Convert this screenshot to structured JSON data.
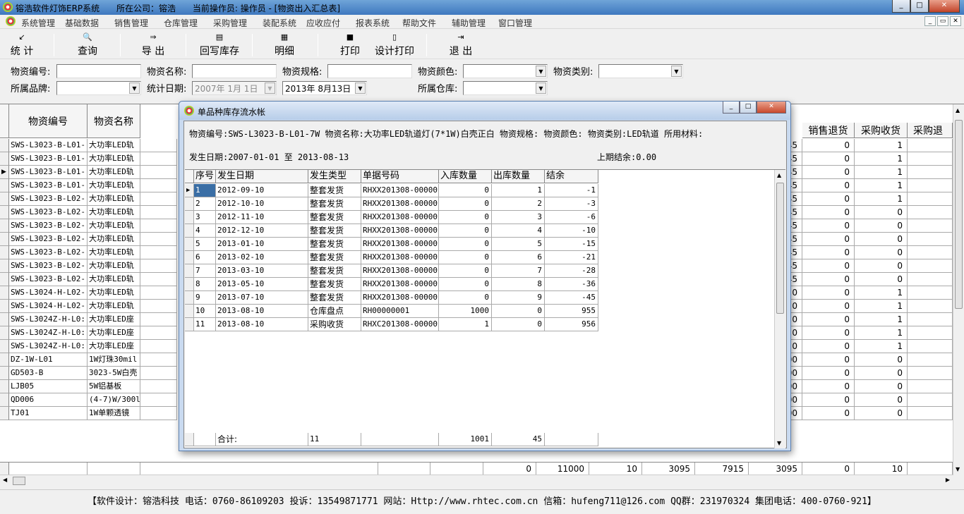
{
  "titlebar": {
    "app": "镕浩软件灯饰ERP系统",
    "company": "所在公司：镕浩",
    "operator": "当前操作员: 操作员 - [物资出入汇总表]",
    "min": "_",
    "max": "□",
    "close": "✕"
  },
  "menu": [
    "系统管理",
    "基础数据",
    "销售管理",
    "仓库管理",
    "采购管理",
    "装配系统",
    "应收应付",
    "报表系统",
    "帮助文件",
    "辅助管理",
    "窗口管理"
  ],
  "mdi_buttons": [
    "_",
    "▭",
    "✕"
  ],
  "toolbar": [
    {
      "label": "统 计",
      "icon": "tally-icon",
      "glyph": "↙"
    },
    {
      "label": "查询",
      "icon": "query-icon",
      "glyph": "🔍"
    },
    {
      "label": "导 出",
      "icon": "export-icon",
      "glyph": "⇒"
    },
    {
      "label": "回写库存",
      "icon": "writeback-icon",
      "glyph": "▤"
    },
    {
      "label": "明细",
      "icon": "detail-icon",
      "glyph": "▦"
    },
    {
      "label": "打印",
      "icon": "print-icon",
      "glyph": "■"
    },
    {
      "label": "设计打印",
      "icon": "design-print-icon",
      "glyph": "▯"
    },
    {
      "label": "退 出",
      "icon": "exit-icon",
      "glyph": "⇥"
    }
  ],
  "filters": {
    "code_label": "物资编号:",
    "name_label": "物资名称:",
    "spec_label": "物资规格:",
    "color_label": "物资颜色:",
    "category_label": "物资类别:",
    "brand_label": "所属品牌:",
    "date_label": "统计日期:",
    "date_from": "2007年 1月 1日",
    "date_to": "2013年 8月13日",
    "warehouse_label": "所属仓库:"
  },
  "main_grid": {
    "headers": [
      "物资编号",
      "物资名称",
      "销售退货",
      "采购收货",
      "采购退"
    ],
    "rows": [
      {
        "code": "SWS-L3023-B-L01-",
        "name": "大功率LED轨",
        "c1": "45",
        "ret": "0",
        "rec": "1"
      },
      {
        "code": "SWS-L3023-B-L01-",
        "name": "大功率LED轨",
        "c1": "45",
        "ret": "0",
        "rec": "1"
      },
      {
        "code": "SWS-L3023-B-L01-",
        "name": "大功率LED轨",
        "c1": "45",
        "ret": "0",
        "rec": "1"
      },
      {
        "code": "SWS-L3023-B-L01-",
        "name": "大功率LED轨",
        "c1": "45",
        "ret": "0",
        "rec": "1"
      },
      {
        "code": "SWS-L3023-B-L02-",
        "name": "大功率LED轨",
        "c1": "45",
        "ret": "0",
        "rec": "1"
      },
      {
        "code": "SWS-L3023-B-L02-",
        "name": "大功率LED轨",
        "c1": "45",
        "ret": "0",
        "rec": "0"
      },
      {
        "code": "SWS-L3023-B-L02-",
        "name": "大功率LED轨",
        "c1": "45",
        "ret": "0",
        "rec": "0"
      },
      {
        "code": "SWS-L3023-B-L02-",
        "name": "大功率LED轨",
        "c1": "45",
        "ret": "0",
        "rec": "0"
      },
      {
        "code": "SWS-L3023-B-L02-",
        "name": "大功率LED轨",
        "c1": "45",
        "ret": "0",
        "rec": "0"
      },
      {
        "code": "SWS-L3023-B-L02-",
        "name": "大功率LED轨",
        "c1": "45",
        "ret": "0",
        "rec": "0"
      },
      {
        "code": "SWS-L3023-B-L02-",
        "name": "大功率LED轨",
        "c1": "45",
        "ret": "0",
        "rec": "0"
      },
      {
        "code": "SWS-L3024-H-L02-",
        "name": "大功率LED轨",
        "c1": "0",
        "ret": "0",
        "rec": "1"
      },
      {
        "code": "SWS-L3024-H-L02-",
        "name": "大功率LED轨",
        "c1": "0",
        "ret": "0",
        "rec": "1"
      },
      {
        "code": "SWS-L3024Z-H-L0:",
        "name": "大功率LED座",
        "c1": "0",
        "ret": "0",
        "rec": "1"
      },
      {
        "code": "SWS-L3024Z-H-L0:",
        "name": "大功率LED座",
        "c1": "0",
        "ret": "0",
        "rec": "1"
      },
      {
        "code": "SWS-L3024Z-H-L0:",
        "name": "大功率LED座",
        "c1": "0",
        "ret": "0",
        "rec": "1"
      },
      {
        "code": "DZ-1W-L01",
        "name": "1W灯珠30mil",
        "c1": "00",
        "ret": "0",
        "rec": "0"
      },
      {
        "code": "GD503-B",
        "name": "3023-5W白壳",
        "c1": "00",
        "ret": "0",
        "rec": "0"
      },
      {
        "code": "LJB05",
        "name": "5W铝基板",
        "c1": "00",
        "ret": "0",
        "rec": "0"
      },
      {
        "code": "QD006",
        "name": "(4-7)W/300l",
        "c1": "00",
        "ret": "0",
        "rec": "0"
      },
      {
        "code": "TJ01",
        "name": "1W单颗透镜",
        "c1": "00",
        "ret": "0",
        "rec": "0"
      }
    ],
    "totals": [
      "0",
      "11000",
      "10",
      "3095",
      "7915",
      "3095",
      "0",
      "10"
    ]
  },
  "modal": {
    "title": "单品种库存流水帐",
    "info_line1": "物资编号:SWS-L3023-B-L01-7W 物资名称:大功率LED轨道灯(7*1W)白壳正白 物资规格: 物资颜色: 物资类别:LED轨道 所用材料:",
    "date_range": "发生日期:2007-01-01 至 2013-08-13",
    "prev_balance": "上期结余:0.00",
    "headers": [
      "序号",
      "发生日期",
      "发生类型",
      "单据号码",
      "入库数量",
      "出库数量",
      "结余"
    ],
    "rows": [
      [
        "1",
        "2012-09-10",
        "整套发货",
        "RHXX201308-00000",
        "0",
        "1",
        "-1"
      ],
      [
        "2",
        "2012-10-10",
        "整套发货",
        "RHXX201308-00000",
        "0",
        "2",
        "-3"
      ],
      [
        "3",
        "2012-11-10",
        "整套发货",
        "RHXX201308-00000",
        "0",
        "3",
        "-6"
      ],
      [
        "4",
        "2012-12-10",
        "整套发货",
        "RHXX201308-00000",
        "0",
        "4",
        "-10"
      ],
      [
        "5",
        "2013-01-10",
        "整套发货",
        "RHXX201308-00000",
        "0",
        "5",
        "-15"
      ],
      [
        "6",
        "2013-02-10",
        "整套发货",
        "RHXX201308-00000",
        "0",
        "6",
        "-21"
      ],
      [
        "7",
        "2013-03-10",
        "整套发货",
        "RHXX201308-00000",
        "0",
        "7",
        "-28"
      ],
      [
        "8",
        "2013-05-10",
        "整套发货",
        "RHXX201308-00000",
        "0",
        "8",
        "-36"
      ],
      [
        "9",
        "2013-07-10",
        "整套发货",
        "RHXX201308-00000",
        "0",
        "9",
        "-45"
      ],
      [
        "10",
        "2013-08-10",
        "仓库盘点",
        "RH00000001",
        "1000",
        "0",
        "955"
      ],
      [
        "11",
        "2013-08-10",
        "采购收货",
        "RHXC201308-00000",
        "1",
        "0",
        "956"
      ]
    ],
    "total_label": "合计:",
    "total_count": "11",
    "total_in": "1001",
    "total_out": "45"
  },
  "statusbar": "【软件设计：镕浩科技 电话：0760-86109203  投诉：13549871771 网站：Http://www.rhtec.com.cn 信箱：hufeng711@126.com QQ群：231970324 集团电话：400-0760-921】"
}
